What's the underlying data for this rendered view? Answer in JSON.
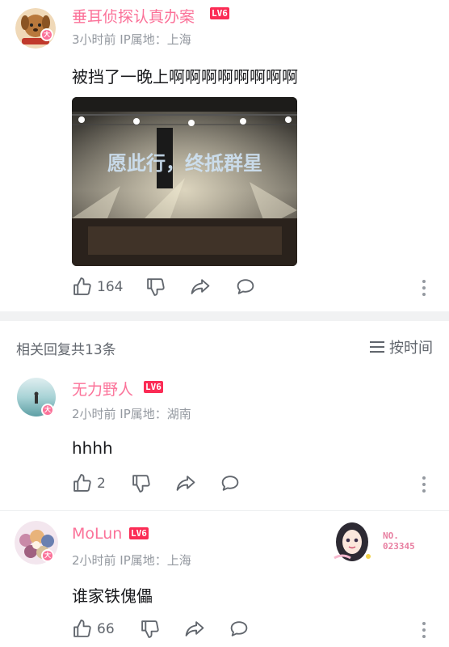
{
  "main_comment": {
    "username": "垂耳侦探认真办案",
    "level": "LV6",
    "meta": "3小时前 IP属地：上海",
    "text": "被挡了一晚上啊啊啊啊啊啊啊啊",
    "photo_caption": "愿此行，终抵群星",
    "likes": "164",
    "vip_badge": "大"
  },
  "replies_header": {
    "count_label": "相关回复共13条",
    "sort_label": "按时间"
  },
  "replies": [
    {
      "username": "无力野人",
      "level": "LV6",
      "meta": "2小时前 IP属地：湖南",
      "text": "hhhh",
      "likes": "2",
      "vip_badge": "大"
    },
    {
      "username": "MoLun",
      "level": "LV6",
      "meta": "2小时前 IP属地：上海",
      "text": "谁家铁傀儡",
      "likes": "66",
      "vip_badge": "大",
      "fan_badge_no": "NO.\n023345"
    }
  ],
  "colors": {
    "accent_pink": "#fb7299",
    "level_red": "#fb2c55",
    "meta_gray": "#9499a0",
    "text_dark": "#18191c"
  },
  "icons": [
    "thumb-up-icon",
    "thumb-down-icon",
    "share-icon",
    "comment-icon",
    "more-vertical-icon",
    "sort-lines-icon"
  ]
}
